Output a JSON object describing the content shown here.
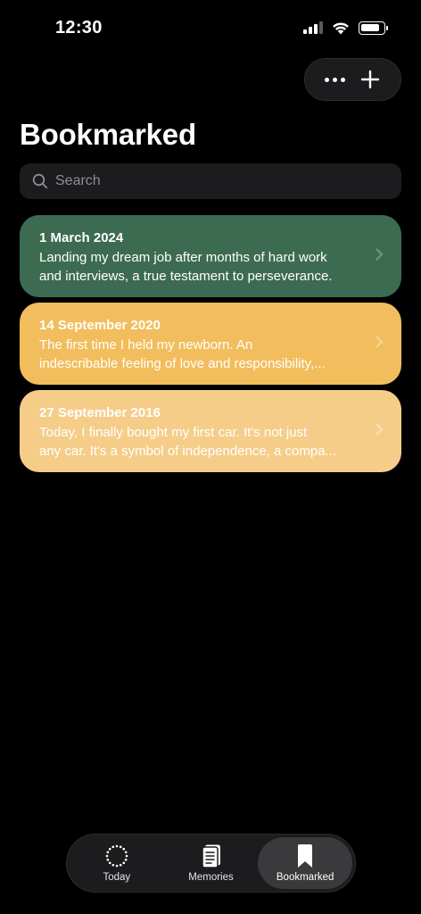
{
  "status_bar": {
    "time": "12:30",
    "signal_bars_active": 3,
    "signal_bars_total": 4,
    "battery_level": 0.85
  },
  "actions": {
    "more_icon": "ellipsis-icon",
    "add_icon": "plus-icon"
  },
  "page": {
    "title": "Bookmarked"
  },
  "search": {
    "placeholder": "Search",
    "value": ""
  },
  "entries": [
    {
      "date": "1 March 2024",
      "text_line1": "Landing my dream job after months of hard work",
      "text_line2": "and interviews, a true testament to perseverance.",
      "color": "#3d6b52",
      "text_color": "#ffffff",
      "chevron_color": "#6f9a82"
    },
    {
      "date": "14 September 2020",
      "text_line1": "The first time I held my newborn. An",
      "text_line2": "indescribable feeling of love and responsibility,...",
      "color": "#f2bd5c",
      "text_color": "#ffffff",
      "chevron_color": "#f7d69a"
    },
    {
      "date": "27 September 2016",
      "text_line1": "Today, I finally bought my first car. It's not just",
      "text_line2": "any car. It's a symbol of independence, a compa...",
      "color": "#f5cd89",
      "text_color": "#ffffff",
      "chevron_color": "#f9e0b6"
    }
  ],
  "tabs": [
    {
      "label": "Today",
      "icon": "dotted-circle-icon",
      "active": false
    },
    {
      "label": "Memories",
      "icon": "journal-icon",
      "active": false
    },
    {
      "label": "Bookmarked",
      "icon": "bookmark-icon",
      "active": true
    }
  ],
  "colors": {
    "background": "#000000",
    "surface": "#1c1c1e",
    "active_tab": "#3a3a3c",
    "placeholder": "#8e8e93"
  }
}
